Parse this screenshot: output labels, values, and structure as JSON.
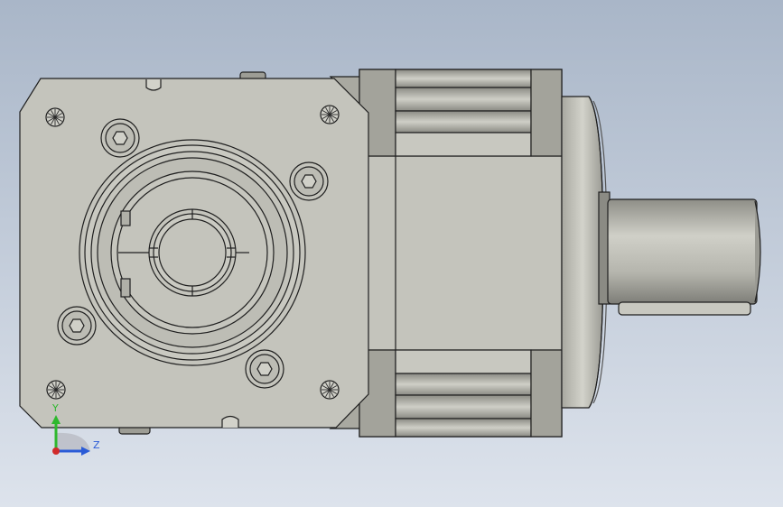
{
  "viewport": {
    "background_top": "#a9b6c8",
    "background_bottom": "#dde3ec"
  },
  "model": {
    "body_color": "#c4c4bc",
    "shaded_color": "#9d9d95",
    "dark_color": "#6f6f69",
    "edge_color": "#1f1f1f",
    "shaft_color": "#b9b9b1"
  },
  "triad": {
    "y_label": "Y",
    "z_label": "Z",
    "y_color": "#2eb82e",
    "z_color": "#2a5bd7",
    "x_color": "#d12a2a"
  },
  "icons": {
    "flange_holes": "hex-socket-bolt-icon",
    "corner_marks": "crosshatch-hole-icon",
    "triad": "axis-triad-icon"
  }
}
